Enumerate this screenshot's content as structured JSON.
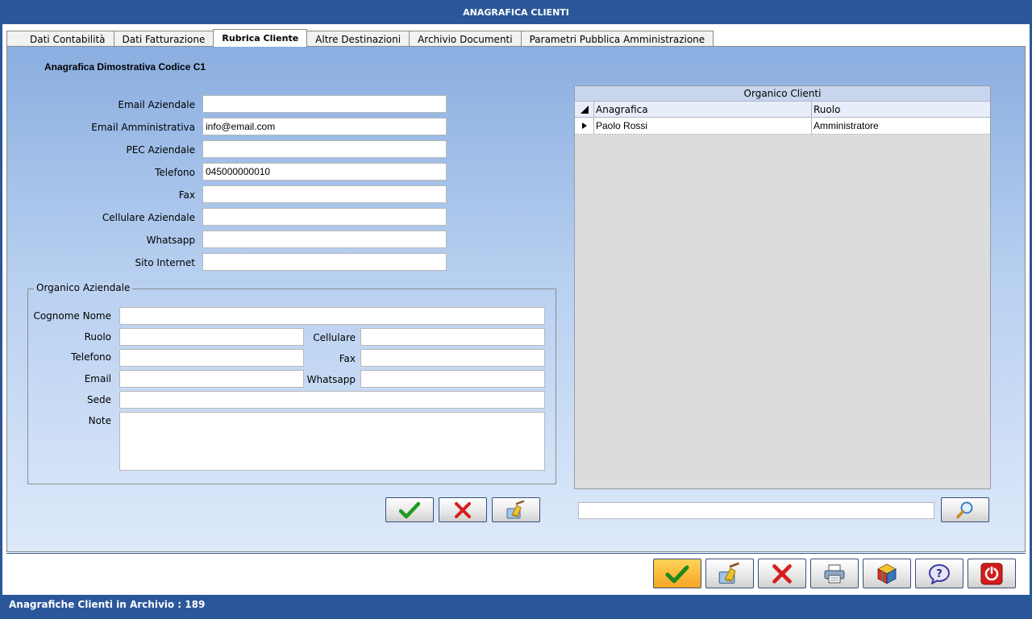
{
  "window": {
    "title": "ANAGRAFICA CLIENTI"
  },
  "tabs": [
    {
      "label": "Dati Contabilità"
    },
    {
      "label": "Dati Fatturazione"
    },
    {
      "label": "Rubrica Cliente"
    },
    {
      "label": "Altre Destinazioni"
    },
    {
      "label": "Archivio Documenti"
    },
    {
      "label": "Parametri Pubblica Amministrazione"
    }
  ],
  "active_tab": "Rubrica Cliente",
  "section_title": "Anagrafica Dimostrativa Codice C1",
  "contacts": {
    "email_aziendale": {
      "label": "Email Aziendale",
      "value": ""
    },
    "email_amministrativa": {
      "label": "Email Amministrativa",
      "value": "info@email.com"
    },
    "pec_aziendale": {
      "label": "PEC Aziendale",
      "value": ""
    },
    "telefono": {
      "label": "Telefono",
      "value": "045000000010"
    },
    "fax": {
      "label": "Fax",
      "value": ""
    },
    "cellulare_aziendale": {
      "label": "Cellulare Aziendale",
      "value": ""
    },
    "whatsapp": {
      "label": "Whatsapp",
      "value": ""
    },
    "sito_internet": {
      "label": "Sito Internet",
      "value": ""
    }
  },
  "organico": {
    "legend": "Organico Aziendale",
    "cognome_nome": {
      "label": "Cognome Nome",
      "value": ""
    },
    "ruolo": {
      "label": "Ruolo",
      "value": ""
    },
    "cellulare": {
      "label": "Cellulare",
      "value": ""
    },
    "telefono": {
      "label": "Telefono",
      "value": ""
    },
    "fax": {
      "label": "Fax",
      "value": ""
    },
    "email": {
      "label": "Email",
      "value": ""
    },
    "whatsapp": {
      "label": "Whatsapp",
      "value": ""
    },
    "sede": {
      "label": "Sede",
      "value": ""
    },
    "note": {
      "label": "Note",
      "value": ""
    }
  },
  "grid": {
    "title": "Organico Clienti",
    "columns": [
      "Anagrafica",
      "Ruolo"
    ],
    "rows": [
      {
        "anagrafica": "Paolo Rossi",
        "ruolo": "Amministratore"
      }
    ]
  },
  "search": {
    "value": ""
  },
  "status": {
    "text": "Anagrafiche Clienti in Archivio :  189"
  },
  "colors": {
    "titlebar": "#2b579a",
    "confirm": "#1e9a1e",
    "cancel": "#d81e1e",
    "accent_gold": "#f5a623"
  },
  "icons": {
    "confirm": "check-icon",
    "cancel": "x-icon",
    "clear": "broom-icon",
    "search": "magnifier-icon",
    "print": "printer-icon",
    "cube": "cube-icon",
    "help": "help-icon",
    "exit": "power-icon"
  }
}
